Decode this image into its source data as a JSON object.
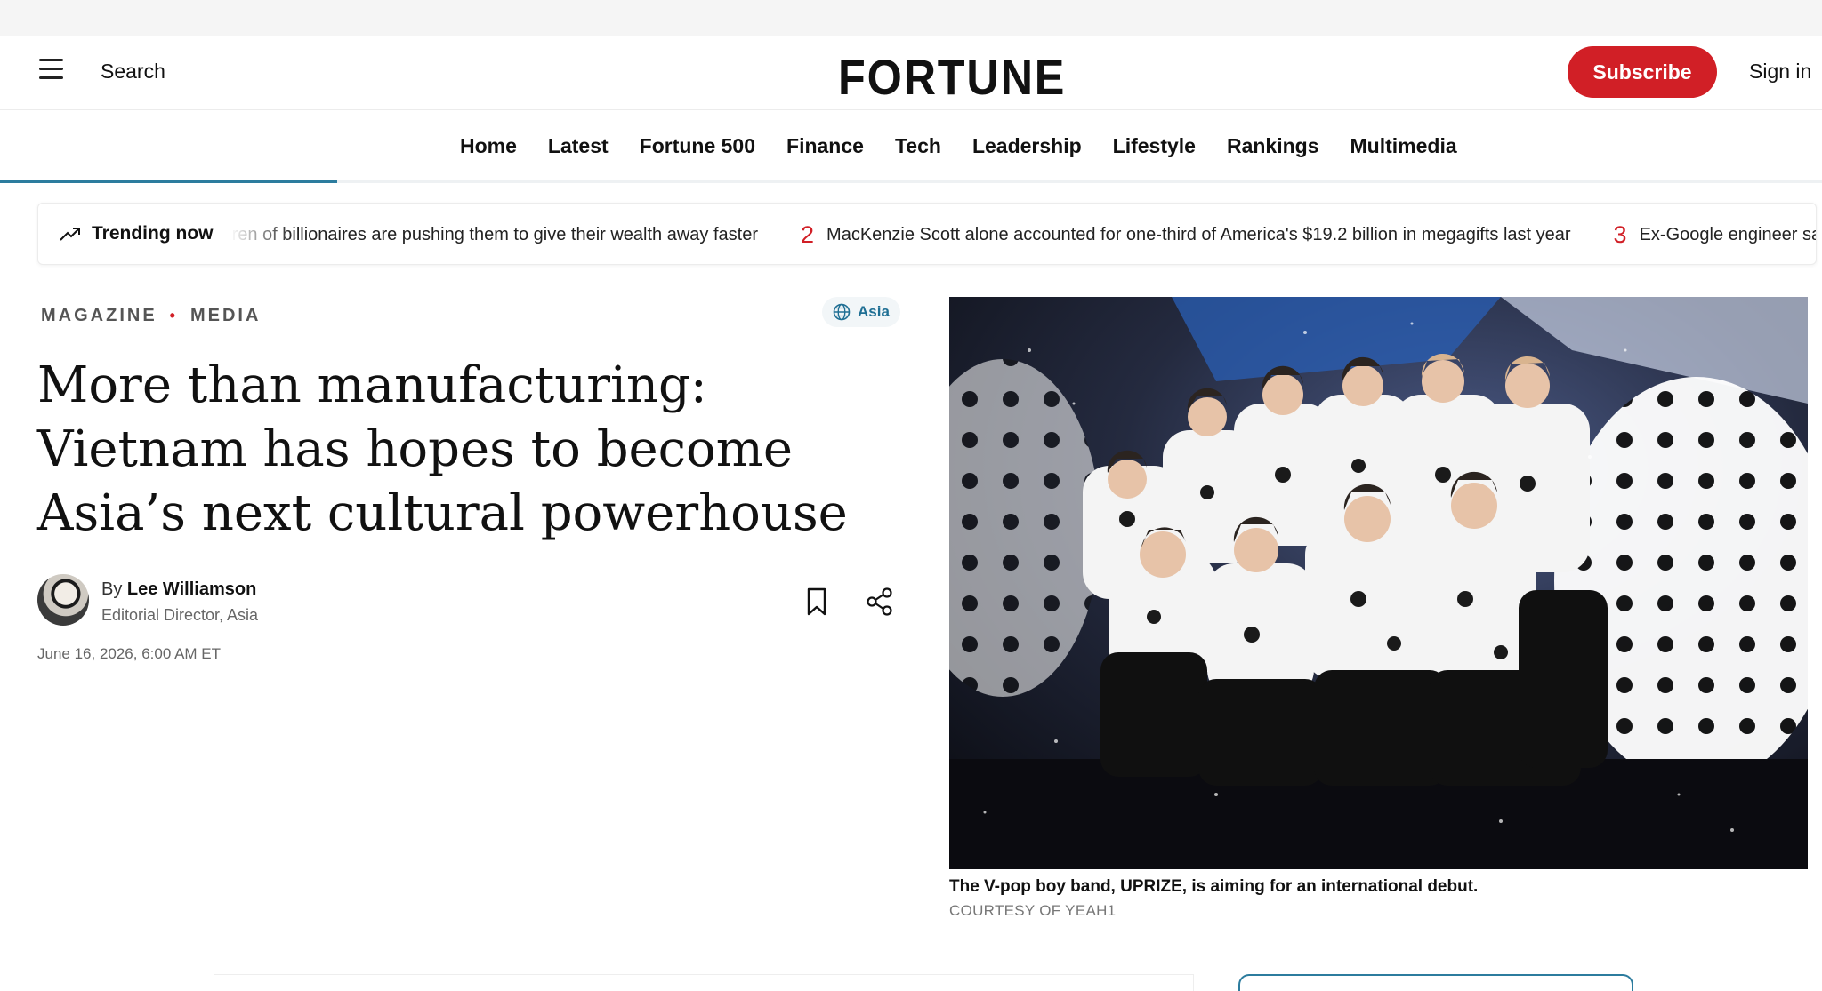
{
  "header": {
    "search_label": "Search",
    "logo": "FORTUNE",
    "subscribe_label": "Subscribe",
    "signin_label": "Sign in"
  },
  "nav": {
    "items": [
      "Home",
      "Latest",
      "Fortune 500",
      "Finance",
      "Tech",
      "Leadership",
      "Lifestyle",
      "Rankings",
      "Multimedia"
    ],
    "reading_progress": 0.185
  },
  "trending": {
    "label": "Trending now",
    "items": [
      {
        "number": "",
        "text": "Children of billionaires are pushing them to give their wealth away faster"
      },
      {
        "number": "2",
        "text": "MacKenzie Scott alone accounted for one-third of America's $19.2 billion in megagifts last year"
      },
      {
        "number": "3",
        "text": "Ex-Google engineer says Larry Pa"
      }
    ]
  },
  "article": {
    "section": "MAGAZINE",
    "subsection": "MEDIA",
    "region": "Asia",
    "headline": "More than manufacturing: Vietnam has hopes to become Asia’s next cultural powerhouse",
    "author_prefix": "By",
    "author": "Lee Williamson",
    "author_role": "Editorial Director, Asia",
    "date": "June 16, 2026, 6:00 AM ET",
    "image_caption": "The V-pop boy band, UPRIZE, is aiming for an international debut.",
    "image_credit": "COURTESY OF YEAH1"
  },
  "icons": {
    "menu": "menu-icon",
    "trending": "trending-up-icon",
    "globe": "globe-icon",
    "bookmark": "bookmark-icon",
    "share": "share-icon"
  },
  "colors": {
    "accent_red": "#d11f26",
    "accent_teal": "#2c7c9e"
  }
}
